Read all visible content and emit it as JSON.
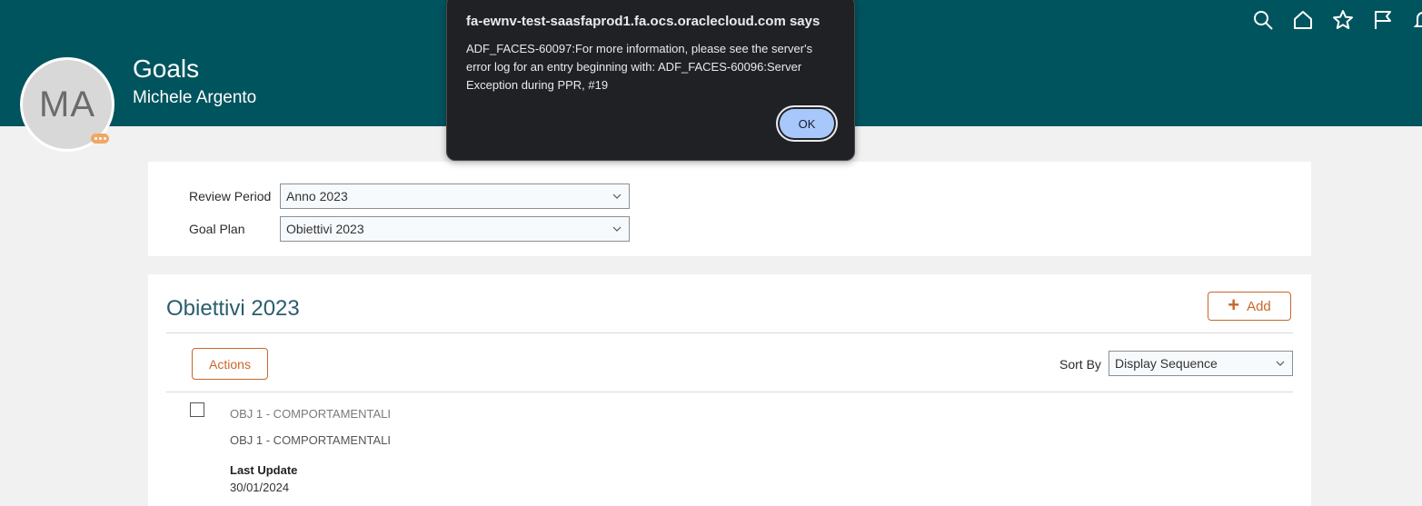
{
  "header": {
    "title": "Goals",
    "subtitle": "Michele Argento",
    "avatar_initials": "MA",
    "bg_color": "#00545e"
  },
  "top_icons": [
    "search-icon",
    "home-icon",
    "star-icon",
    "flag-icon",
    "bell-icon"
  ],
  "filters": {
    "review_period_label": "Review Period",
    "review_period_value": "Anno 2023",
    "goal_plan_label": "Goal Plan",
    "goal_plan_value": "Obiettivi 2023"
  },
  "section": {
    "title": "Obiettivi 2023",
    "add_label": "Add",
    "actions_label": "Actions",
    "sort_by_label": "Sort By",
    "sort_by_value": "Display Sequence"
  },
  "goals": [
    {
      "name": "OBJ 1 - COMPORTAMENTALI",
      "description": "OBJ 1 - COMPORTAMENTALI",
      "last_update_label": "Last Update",
      "last_update_value": "30/01/2024"
    }
  ],
  "dialog": {
    "title": "fa-ewnv-test-saasfaprod1.fa.ocs.oraclecloud.com says",
    "message": "ADF_FACES-60097:For more information, please see the server's error log for an entry beginning with: ADF_FACES-60096:Server Exception during PPR, #19",
    "ok_label": "OK"
  },
  "colors": {
    "accent": "#c9662a",
    "title_teal": "#2a5e6c",
    "dialog_button": "#a8c7fa"
  }
}
